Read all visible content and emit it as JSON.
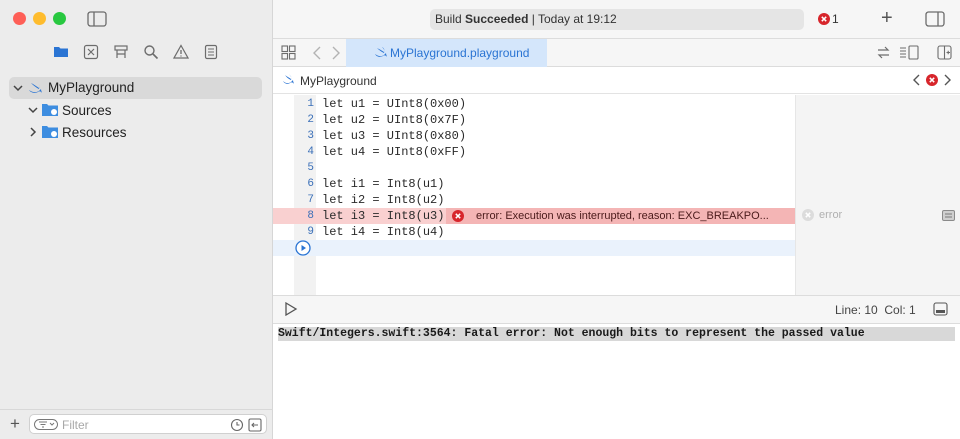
{
  "toolbar": {
    "status_prefix": "Build ",
    "status_bold": "Succeeded",
    "status_suffix": " | Today at 19:12",
    "error_count": "1"
  },
  "tab": {
    "label": "MyPlayground.playground"
  },
  "jumpbar": {
    "label": "MyPlayground"
  },
  "navigator": {
    "project": "MyPlayground",
    "items": [
      {
        "label": "Sources"
      },
      {
        "label": "Resources"
      }
    ],
    "filter_placeholder": "Filter"
  },
  "editor": {
    "line_numbers": [
      "1",
      "2",
      "3",
      "4",
      "5",
      "6",
      "7",
      "8",
      "9"
    ],
    "lines": [
      "let u1 = UInt8(0x00)",
      "let u2 = UInt8(0x7F)",
      "let u3 = UInt8(0x80)",
      "let u4 = UInt8(0xFF)",
      "",
      "let i1 = Int8(u1)",
      "let i2 = Int8(u2)",
      "let i3 = Int8(u3)",
      "let i4 = Int8(u4)"
    ],
    "error_message": "error: Execution was interrupted, reason: EXC_BREAKPO...",
    "result_error": "error"
  },
  "debugbar": {
    "position": "Line: 10  Col: 1"
  },
  "console": {
    "output": "Swift/Integers.swift:3564: Fatal error: Not enough bits to represent the passed value"
  },
  "colors": {
    "accent": "#2a74d3",
    "error": "#d7252b",
    "error_line": "#f9d0d0"
  }
}
